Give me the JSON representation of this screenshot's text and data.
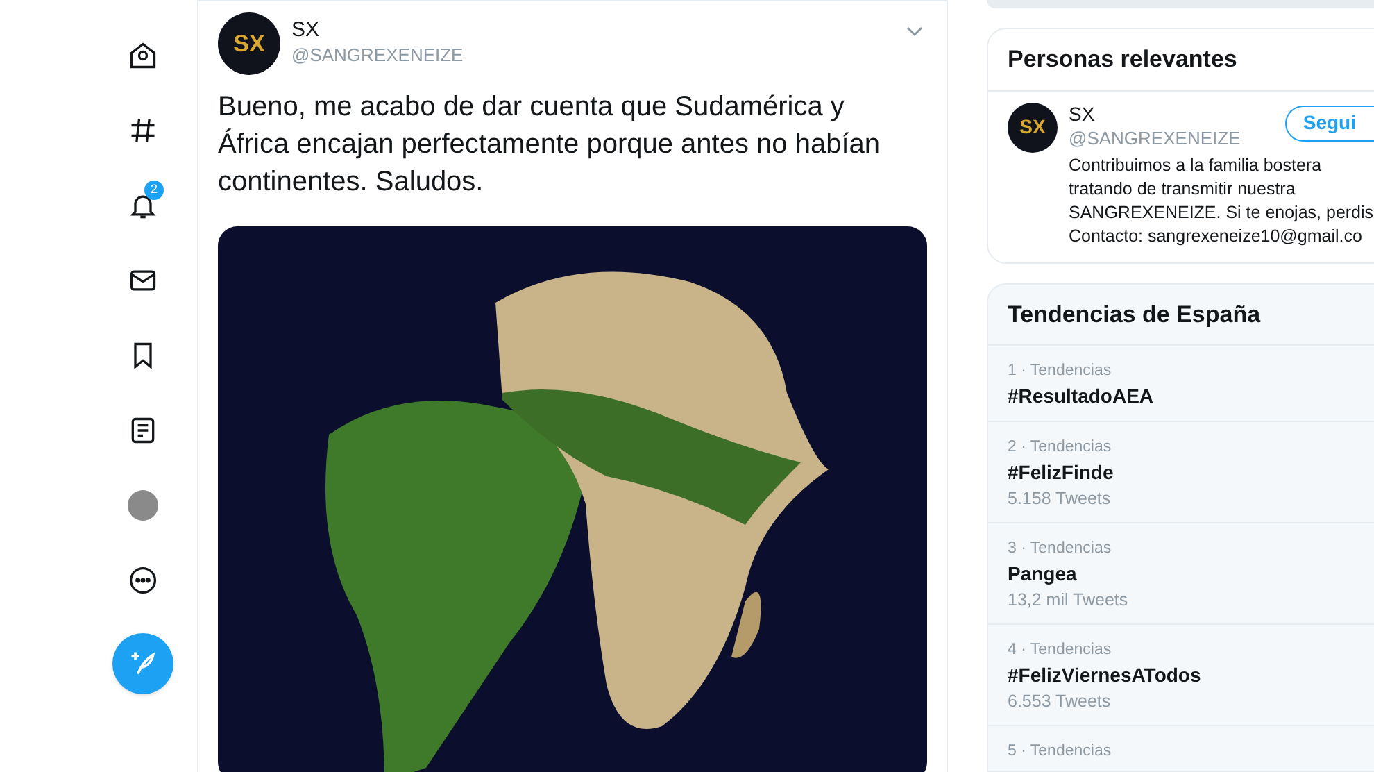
{
  "nav": [
    {
      "kind": "home"
    },
    {
      "kind": "explore"
    },
    {
      "kind": "notifications",
      "badge": "2"
    },
    {
      "kind": "messages"
    },
    {
      "kind": "bookmarks"
    },
    {
      "kind": "lists"
    },
    {
      "kind": "profile"
    },
    {
      "kind": "more"
    }
  ],
  "tweet": {
    "avatar": "SX",
    "name": "SX",
    "handle": "@SANGREXENEIZE",
    "text": "Bueno, me acabo de dar cuenta que Sudamérica y África encajan perfectamente porque antes no habían continentes. Saludos."
  },
  "relevant_people": {
    "title": "Personas relevantes",
    "person": {
      "avatar": "SX",
      "name": "SX",
      "handle": "@SANGREXENEIZE",
      "follow_button": "Segui",
      "bio": [
        "Contribuimos a la familia bostera",
        "tratando de transmitir nuestra",
        "SANGREXENEIZE. Si te enojas, perdis",
        "Contacto: sangrexeneize10@gmail.co"
      ]
    }
  },
  "trends": {
    "title": "Tendencias de España",
    "items": [
      {
        "context": "1 · Tendencias",
        "name": "#ResultadoAEA"
      },
      {
        "context": "2 · Tendencias",
        "name": "#FelizFinde",
        "count": "5.158 Tweets"
      },
      {
        "context": "3 · Tendencias",
        "name": "Pangea",
        "count": "13,2 mil Tweets"
      },
      {
        "context": "4 · Tendencias",
        "name": "#FelizViernesATodos",
        "count": "6.553 Tweets"
      },
      {
        "context": "5 · Tendencias"
      }
    ]
  }
}
